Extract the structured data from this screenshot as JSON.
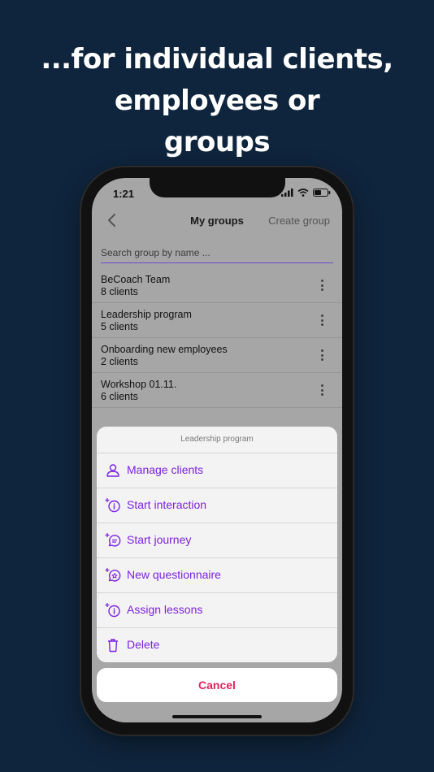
{
  "headline": [
    "...for individual clients,",
    "employees or",
    "groups"
  ],
  "status": {
    "time": "1:21"
  },
  "nav": {
    "title": "My groups",
    "create": "Create group"
  },
  "search": {
    "placeholder": "Search group by name ..."
  },
  "groups": [
    {
      "name": "BeCoach Team",
      "count": "8 clients"
    },
    {
      "name": "Leadership program",
      "count": "5 clients"
    },
    {
      "name": "Onboarding new employees",
      "count": "2 clients"
    },
    {
      "name": "Workshop 01.11.",
      "count": "6 clients"
    }
  ],
  "sheet": {
    "title": "Leadership program",
    "actions": [
      {
        "label": "Manage clients",
        "icon": "person-icon"
      },
      {
        "label": "Start interaction",
        "icon": "interaction-plus-icon"
      },
      {
        "label": "Start journey",
        "icon": "journey-plus-icon"
      },
      {
        "label": "New questionnaire",
        "icon": "questionnaire-plus-icon"
      },
      {
        "label": "Assign lessons",
        "icon": "lesson-plus-icon"
      },
      {
        "label": "Delete",
        "icon": "trash-icon"
      }
    ],
    "cancel": "Cancel"
  },
  "colors": {
    "background": "#0f253d",
    "accent": "#7b22e0",
    "cancel": "#e0245e",
    "underline": "#6a4bd0"
  }
}
